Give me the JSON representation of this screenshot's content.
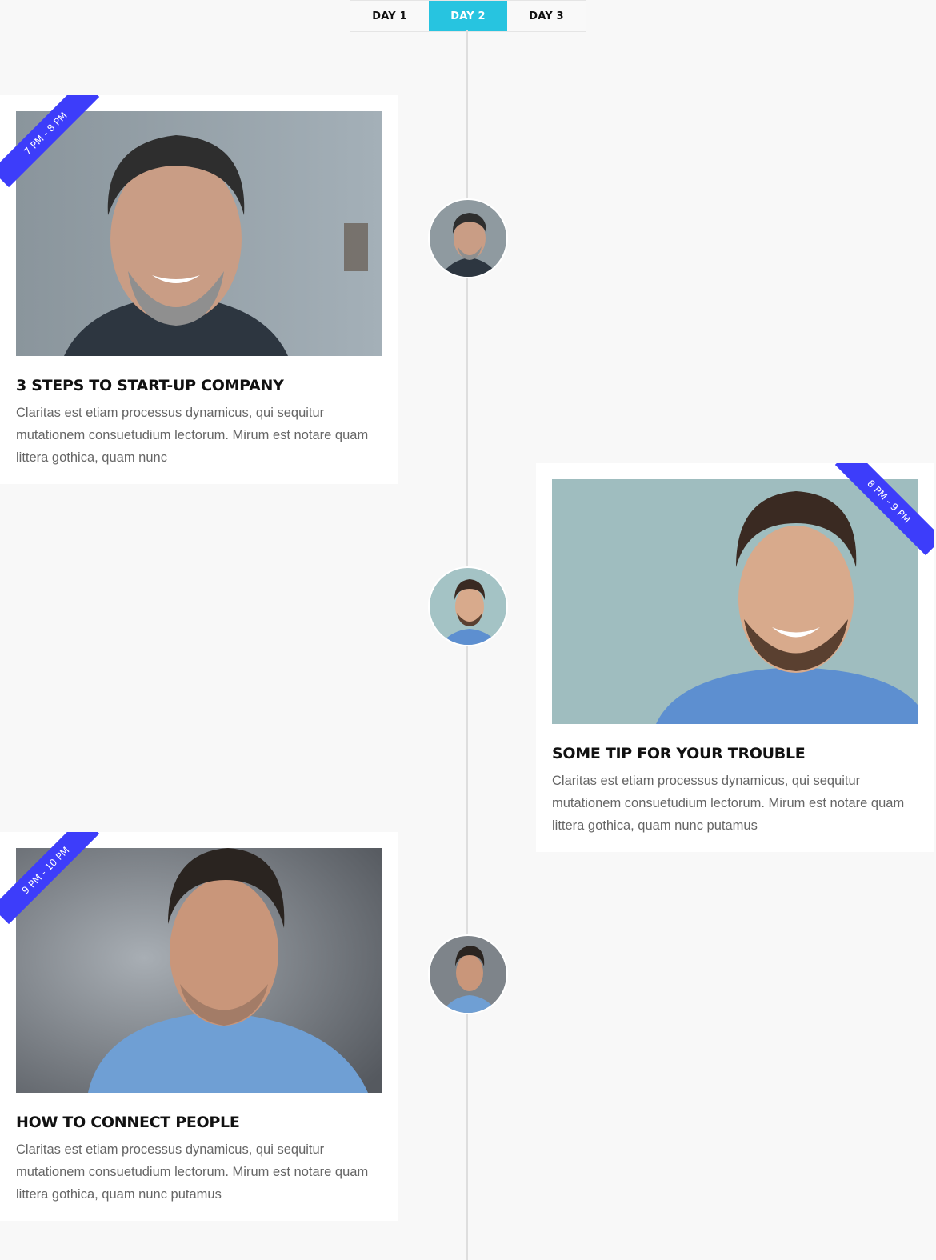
{
  "tabs": [
    {
      "label": "DAY 1",
      "active": false
    },
    {
      "label": "DAY 2",
      "active": true
    },
    {
      "label": "DAY 3",
      "active": false
    }
  ],
  "accent_colors": {
    "active_tab": "#27c4e0",
    "ribbon": "#3d3dfa"
  },
  "sessions": [
    {
      "time": "7 PM - 8 PM",
      "title": "3 STEPS TO START-UP COMPANY",
      "text": "Claritas est etiam processus dynamicus, qui sequitur mutationem consuetudium lectorum. Mirum est notare quam littera gothica, quam nunc",
      "photo_icon": "speaker-photo-gray-haired-man"
    },
    {
      "time": "8 PM - 9 PM",
      "title": "SOME TIP FOR YOUR TROUBLE",
      "text": "Claritas est etiam processus dynamicus, qui sequitur mutationem consuetudium lectorum. Mirum est notare quam littera gothica, quam nunc putamus",
      "photo_icon": "speaker-photo-smiling-man"
    },
    {
      "time": "9 PM - 10 PM",
      "title": "HOW TO CONNECT PEOPLE",
      "text": "Claritas est etiam processus dynamicus, qui sequitur mutationem consuetudium lectorum. Mirum est notare quam littera gothica, quam nunc putamus",
      "photo_icon": "speaker-photo-man-blue-shirt"
    }
  ]
}
